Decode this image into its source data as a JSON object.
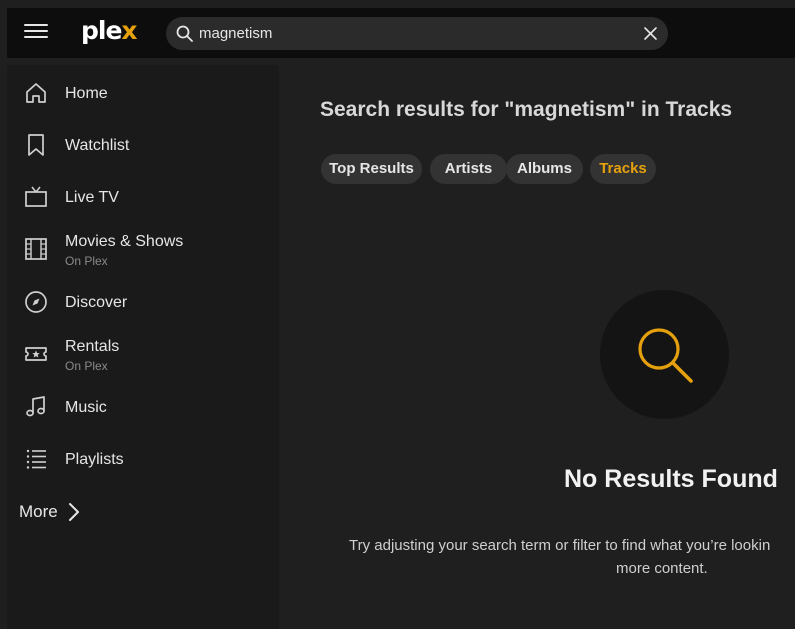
{
  "header": {
    "logo_text": "ple",
    "logo_accent": "x",
    "accent_color": "#e5a00d",
    "search": {
      "value": "magnetism",
      "icon": "search-icon",
      "clear_icon": "close-icon"
    }
  },
  "sidebar": {
    "items": [
      {
        "label": "Home",
        "sub": "",
        "icon": "home-icon"
      },
      {
        "label": "Watchlist",
        "sub": "",
        "icon": "bookmark-icon"
      },
      {
        "label": "Live TV",
        "sub": "",
        "icon": "tv-icon"
      },
      {
        "label": "Movies & Shows",
        "sub": "On Plex",
        "icon": "film-icon"
      },
      {
        "label": "Discover",
        "sub": "",
        "icon": "compass-icon"
      },
      {
        "label": "Rentals",
        "sub": "On Plex",
        "icon": "ticket-star-icon"
      },
      {
        "label": "Music",
        "sub": "",
        "icon": "music-note-icon"
      },
      {
        "label": "Playlists",
        "sub": "",
        "icon": "list-icon"
      }
    ],
    "more_label": "More"
  },
  "main": {
    "title": "Search results for \"magnetism\" in Tracks",
    "filters": [
      {
        "label": "Top Results",
        "active": false
      },
      {
        "label": "Artists",
        "active": false
      },
      {
        "label": "Albums",
        "active": false
      },
      {
        "label": "Tracks",
        "active": true
      }
    ],
    "empty": {
      "title": "No Results Found",
      "line1": "Try adjusting your search term or filter to find what you’re lookin",
      "line2": "more content."
    }
  }
}
